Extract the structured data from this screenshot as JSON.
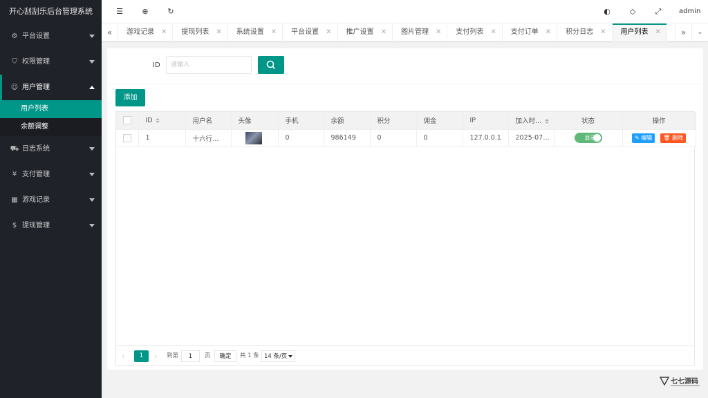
{
  "app": {
    "title": "开心刮刮乐后台管理系统"
  },
  "sidebar": {
    "items": [
      {
        "label": "平台设置",
        "icon": "gear-icon"
      },
      {
        "label": "权限管理",
        "icon": "shield-icon"
      },
      {
        "label": "用户管理",
        "icon": "user-icon",
        "children": [
          {
            "label": "用户列表"
          },
          {
            "label": "余额调整"
          }
        ]
      },
      {
        "label": "日志系统",
        "icon": "car-icon"
      },
      {
        "label": "支付管理",
        "icon": "yen-icon"
      },
      {
        "label": "游戏记录",
        "icon": "game-icon"
      },
      {
        "label": "提现管理",
        "icon": "dollar-icon"
      }
    ]
  },
  "header": {
    "icons": [
      "menu-toggle-icon",
      "globe-icon",
      "refresh-icon",
      "theme-icon",
      "tag-icon",
      "fullscreen-icon"
    ],
    "user": "admin"
  },
  "tabs": [
    {
      "label": "游戏记录"
    },
    {
      "label": "提现列表"
    },
    {
      "label": "系统设置"
    },
    {
      "label": "平台设置"
    },
    {
      "label": "推广设置"
    },
    {
      "label": "图片管理"
    },
    {
      "label": "支付列表"
    },
    {
      "label": "支付订单"
    },
    {
      "label": "积分日志"
    },
    {
      "label": "用户列表",
      "active": true
    }
  ],
  "search": {
    "label": "ID",
    "placeholder": "请输入"
  },
  "toolbar": {
    "add_label": "添加"
  },
  "table": {
    "columns": [
      "ID",
      "用户名",
      "头像",
      "手机",
      "余额",
      "积分",
      "佣金",
      "IP",
      "加入时…",
      "状态",
      "操作"
    ],
    "rows": [
      {
        "id": "1",
        "username": "十六行…",
        "phone": "0",
        "balance": "986149",
        "points": "0",
        "commission": "0",
        "ip": "127.0.0.1",
        "joined": "2025-07…",
        "status": "显示"
      }
    ],
    "actions": {
      "edit": "编辑",
      "delete": "删除"
    }
  },
  "pager": {
    "current": "1",
    "goto_label": "到第",
    "goto_value": "1",
    "page_label": "页",
    "confirm_label": "确定",
    "total_label": "共 1 条",
    "page_size": "14 条/页"
  },
  "watermark": {
    "text": "七七源码"
  },
  "colors": {
    "primary": "#009688",
    "sidebar": "#20222a",
    "edit": "#1e9fff",
    "delete": "#ff5722",
    "switch_on": "#5fb878"
  }
}
